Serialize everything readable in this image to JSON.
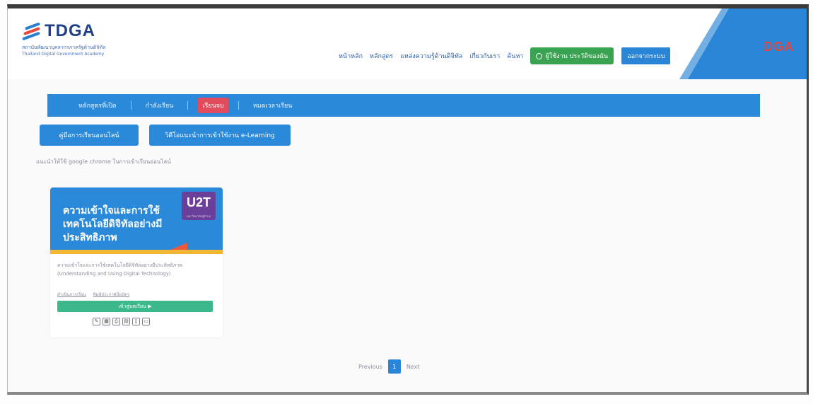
{
  "header": {
    "logo": {
      "word": "TDGA",
      "subtitle_th": "สถาบันพัฒนาบุคลากรภาครัฐด้านดิจิทัล",
      "subtitle_en": "Thailand Digital Government Academy"
    },
    "nav": [
      "หน้าหลัก",
      "หลักสูตร",
      "แหล่งความรู้ด้านดิจิทัล",
      "เกี่ยวกับเรา",
      "ค้นหา"
    ],
    "user_button": "ผู้ใช้งาน ประวัติของฉัน",
    "logout_button": "ออกจากระบบ",
    "partner_logo": "DGA"
  },
  "tabs": [
    "หลักสูตรที่เปิด",
    "กำลังเรียน",
    "เรียนจบ",
    "หมดเวลาเรียน"
  ],
  "active_tab": 2,
  "guides": {
    "manual_button": "คู่มือการเรียนออนไลน์",
    "video_button": "วิดีโอแนะนำการเข้าใช้งาน e-Learning",
    "note": "แนะนำให้ใช้ google chrome ในการเข้าเรียนออนไลน์"
  },
  "course": {
    "banner_title": "ความเข้าใจและการใช้เทคโนโลยีดิจิทัลอย่างมีประสิทธิภาพ",
    "badge": "U2T",
    "badge_sub": "มหาวิทยาลัยสู่ตำบล",
    "desc_th": "ความเข้าใจและการใช้เทคโนโลยีดิจิทัลอย่างมีประสิทธิภาพ",
    "desc_en": "(Understanding and Using Digital Technology)",
    "meta_1": "ดำเนินการเรียน",
    "meta_2": "พิมพ์ประกาศนียบัตร",
    "enter_button": "เข้าสู่บทเรียน ▶",
    "share_icons": [
      "edit-icon",
      "calendar-icon",
      "print-icon",
      "document-icon",
      "clipboard-icon",
      "chat-icon"
    ]
  },
  "pagination": {
    "previous": "Previous",
    "page": "1",
    "next": "Next"
  },
  "colors": {
    "primary_blue": "#2a8ad9",
    "active_tab_red": "#e24b5b",
    "green": "#39a351",
    "logo_navy": "#1f3f8a",
    "dga_red": "#e8463b"
  }
}
